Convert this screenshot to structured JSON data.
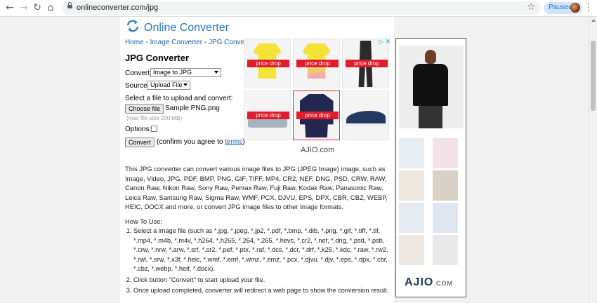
{
  "browser": {
    "url": "onlineconverter.com/jpg",
    "profile_status": "Paused"
  },
  "site": {
    "logo_text": "Online Converter",
    "breadcrumb": [
      {
        "label": "Home"
      },
      {
        "label": "Image Converter"
      },
      {
        "label": "JPG Converter"
      }
    ],
    "breadcrumb_separator": " - "
  },
  "converter": {
    "title": "JPG Converter",
    "convert_label": "Convert:",
    "convert_value": "Image to JPG",
    "source_label": "Source:",
    "source_value": "Upload File",
    "select_prompt": "Select a file to upload and convert:",
    "choose_file_label": "Choose file",
    "file_name": "Sample PNG.png",
    "max_size_note": "(max file size 200 MB)",
    "options_label": "Options:",
    "convert_button": "Convert",
    "confirm_text": "(confirm you agree to ",
    "terms_link": "terms",
    "confirm_close": ")"
  },
  "ad": {
    "badge_text": "price drop",
    "brand_caption": "AJIO.com",
    "side_brand": "AJIO",
    "side_brand_suffix": ".COM",
    "ad_icons": "▷ ✕"
  },
  "content": {
    "description": "This JPG converter can convert various image files to JPG (JPEG Image) image, such as Image, Video, JPG, PDF, BMP, PNG, GIF, TIFF, MP4, CR2, NEF, DNG, PSD, CRW, RAW, Canon Raw, Nikon Raw, Sony Raw, Pentax Raw, Fuji Raw, Kodak Raw, Panasonic Raw, Leica Raw, Samsung Raw, Sigma Raw, WMF, PCX, DJVU, EPS, DPX, CBR, CBZ, WEBP, HEIC, DOCX and more, or convert JPG image files to other image formats.",
    "how_to_title": "How To Use:",
    "steps": [
      "Select a image file (such as *.jpg, *.jpeg, *.jp2, *.pdf, *.bmp, *.dib, *.png, *.gif, *.tiff, *.tif, *.mp4, *.m4b, *.m4v, *.h264, *.h265, *.264, *.265, *.hevc, *.cr2, *.nef, *.dng, *.psd, *.psb, *.crw, *.nrw, *.arw, *.srf, *.sr2, *.pef, *.ptx, *.raf, *.dcs, *.dcr, *.drf, *.k25, *.kdc, *.raw, *.rw2, *.rwl, *.srw, *.x3f, *.heic, *.wmf, *.emf, *.wmz, *.emz, *.pcx, *.djvu, *.djv, *.eps, *.dpx, *.cbr, *.cbz, *.webp, *.heif, *.docx).",
      "Click button \"Convert\" to start upload your file.",
      "Once upload completed, converter will redirect a web page to show the conversion result."
    ]
  },
  "colors": {
    "link": "#1a5fb4",
    "logo": "#2a7ac0",
    "badge": "#e11d2b"
  }
}
